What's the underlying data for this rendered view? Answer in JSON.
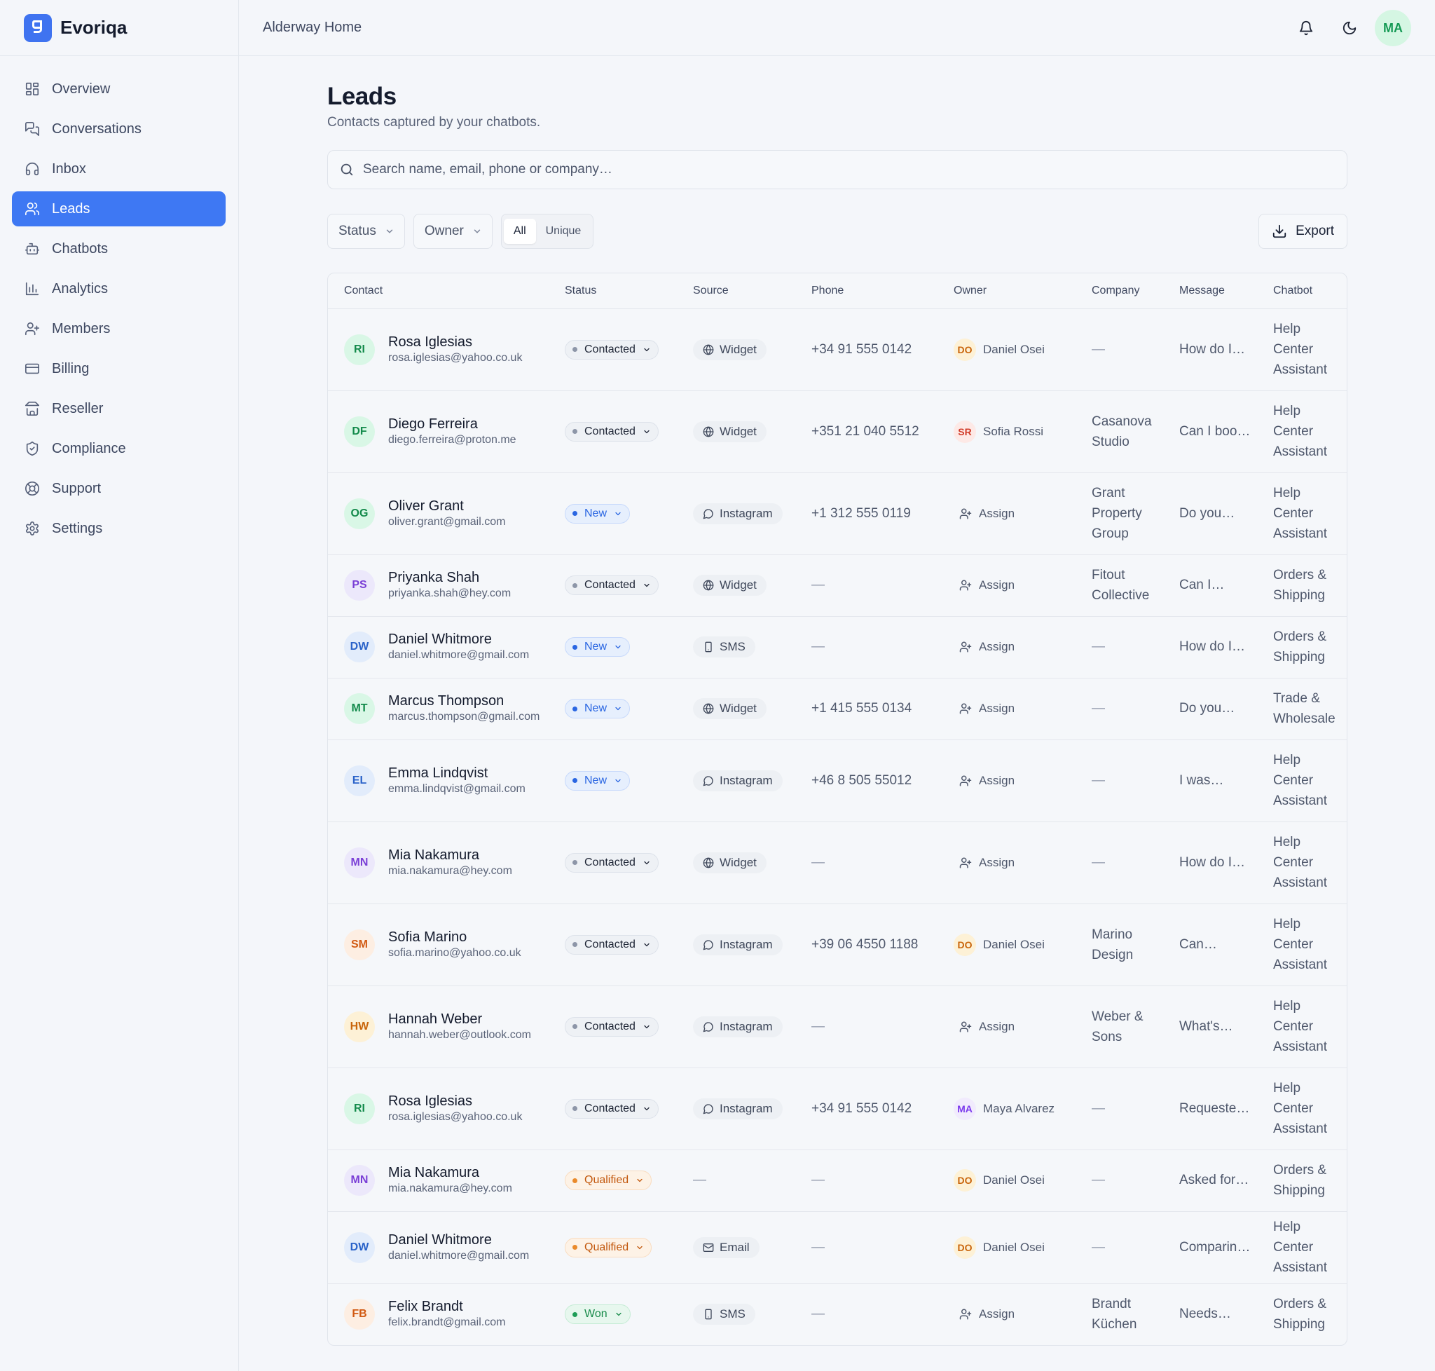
{
  "brand": {
    "name": "Evoriqa"
  },
  "workspace": "Alderway Home",
  "user": {
    "initials": "MA"
  },
  "colors": {
    "accent": "#3e78f3"
  },
  "nav": [
    {
      "label": "Overview",
      "icon": "grid-icon"
    },
    {
      "label": "Conversations",
      "icon": "chat-icon"
    },
    {
      "label": "Inbox",
      "icon": "headset-icon"
    },
    {
      "label": "Leads",
      "icon": "users-icon",
      "active": true
    },
    {
      "label": "Chatbots",
      "icon": "bot-icon"
    },
    {
      "label": "Analytics",
      "icon": "bar-chart-icon"
    },
    {
      "label": "Members",
      "icon": "user-plus-icon"
    },
    {
      "label": "Billing",
      "icon": "credit-card-icon"
    },
    {
      "label": "Reseller",
      "icon": "store-icon"
    },
    {
      "label": "Compliance",
      "icon": "shield-icon"
    },
    {
      "label": "Support",
      "icon": "lifebuoy-icon"
    },
    {
      "label": "Settings",
      "icon": "gear-icon"
    }
  ],
  "page": {
    "title": "Leads",
    "subtitle": "Contacts captured by your chatbots."
  },
  "search": {
    "placeholder": "Search name, email, phone or company…",
    "value": ""
  },
  "filters": {
    "status_label": "Status",
    "owner_label": "Owner",
    "segment": [
      "All",
      "Unique"
    ],
    "segment_selected": "All",
    "export_label": "Export"
  },
  "table": {
    "columns": [
      "Contact",
      "Status",
      "Source",
      "Phone",
      "Owner",
      "Company",
      "Message",
      "Chatbot"
    ],
    "assign_label": "Assign",
    "empty": "—",
    "rows": [
      {
        "initials": "RI",
        "avatar": "green",
        "name": "Rosa Iglesias",
        "email": "rosa.iglesias@yahoo.co.uk",
        "status": "Contacted",
        "source": "Widget",
        "phone": "+34 91 555 0142",
        "owner": {
          "initials": "DO",
          "name": "Daniel Osei",
          "color": "amber"
        },
        "company": "",
        "message": "How do I…",
        "chatbot": "Help Center Assistant"
      },
      {
        "initials": "DF",
        "avatar": "green",
        "name": "Diego Ferreira",
        "email": "diego.ferreira@proton.me",
        "status": "Contacted",
        "source": "Widget",
        "phone": "+351 21 040 5512",
        "owner": {
          "initials": "SR",
          "name": "Sofia Rossi",
          "color": "red"
        },
        "company": "Casanova Studio",
        "message": "Can I boo…",
        "chatbot": "Help Center Assistant"
      },
      {
        "initials": "OG",
        "avatar": "green",
        "name": "Oliver Grant",
        "email": "oliver.grant@gmail.com",
        "status": "New",
        "source": "Instagram",
        "phone": "+1 312 555 0119",
        "owner": null,
        "company": "Grant Property Group",
        "message": "Do you…",
        "chatbot": "Help Center Assistant"
      },
      {
        "initials": "PS",
        "avatar": "purple",
        "name": "Priyanka Shah",
        "email": "priyanka.shah@hey.com",
        "status": "Contacted",
        "source": "Widget",
        "phone": "",
        "owner": null,
        "company": "Fitout Collective",
        "message": "Can I…",
        "chatbot": "Orders & Shipping"
      },
      {
        "initials": "DW",
        "avatar": "blue",
        "name": "Daniel Whitmore",
        "email": "daniel.whitmore@gmail.com",
        "status": "New",
        "source": "SMS",
        "phone": "",
        "owner": null,
        "company": "",
        "message": "How do I…",
        "chatbot": "Orders & Shipping"
      },
      {
        "initials": "MT",
        "avatar": "green",
        "name": "Marcus Thompson",
        "email": "marcus.thompson@gmail.com",
        "status": "New",
        "source": "Widget",
        "phone": "+1 415 555 0134",
        "owner": null,
        "company": "",
        "message": "Do you…",
        "chatbot": "Trade & Wholesale"
      },
      {
        "initials": "EL",
        "avatar": "blue",
        "name": "Emma Lindqvist",
        "email": "emma.lindqvist@gmail.com",
        "status": "New",
        "source": "Instagram",
        "phone": "+46 8 505 55012",
        "owner": null,
        "company": "",
        "message": "I was…",
        "chatbot": "Help Center Assistant"
      },
      {
        "initials": "MN",
        "avatar": "purple",
        "name": "Mia Nakamura",
        "email": "mia.nakamura@hey.com",
        "status": "Contacted",
        "source": "Widget",
        "phone": "",
        "owner": null,
        "company": "",
        "message": "How do I…",
        "chatbot": "Help Center Assistant"
      },
      {
        "initials": "SM",
        "avatar": "orange",
        "name": "Sofia Marino",
        "email": "sofia.marino@yahoo.co.uk",
        "status": "Contacted",
        "source": "Instagram",
        "phone": "+39 06 4550 1188",
        "owner": {
          "initials": "DO",
          "name": "Daniel Osei",
          "color": "amber"
        },
        "company": "Marino Design",
        "message": "Can…",
        "chatbot": "Help Center Assistant"
      },
      {
        "initials": "HW",
        "avatar": "amber",
        "name": "Hannah Weber",
        "email": "hannah.weber@outlook.com",
        "status": "Contacted",
        "source": "Instagram",
        "phone": "",
        "owner": null,
        "company": "Weber & Sons",
        "message": "What's…",
        "chatbot": "Help Center Assistant"
      },
      {
        "initials": "RI",
        "avatar": "green",
        "name": "Rosa Iglesias",
        "email": "rosa.iglesias@yahoo.co.uk",
        "status": "Contacted",
        "source": "Instagram",
        "phone": "+34 91 555 0142",
        "owner": {
          "initials": "MA",
          "name": "Maya Alvarez",
          "color": "violet"
        },
        "company": "",
        "message": "Requeste…",
        "chatbot": "Help Center Assistant"
      },
      {
        "initials": "MN",
        "avatar": "purple",
        "name": "Mia Nakamura",
        "email": "mia.nakamura@hey.com",
        "status": "Qualified",
        "source": "",
        "phone": "",
        "owner": {
          "initials": "DO",
          "name": "Daniel Osei",
          "color": "amber"
        },
        "company": "",
        "message": "Asked for…",
        "chatbot": "Orders & Shipping"
      },
      {
        "initials": "DW",
        "avatar": "blue",
        "name": "Daniel Whitmore",
        "email": "daniel.whitmore@gmail.com",
        "status": "Qualified",
        "source": "Email",
        "phone": "",
        "owner": {
          "initials": "DO",
          "name": "Daniel Osei",
          "color": "amber"
        },
        "company": "",
        "message": "Comparin…",
        "chatbot": "Help Center Assistant"
      },
      {
        "initials": "FB",
        "avatar": "orange",
        "name": "Felix Brandt",
        "email": "felix.brandt@gmail.com",
        "status": "Won",
        "source": "SMS",
        "phone": "",
        "owner": null,
        "company": "Brandt Küchen",
        "message": "Needs…",
        "chatbot": "Orders & Shipping"
      }
    ]
  }
}
